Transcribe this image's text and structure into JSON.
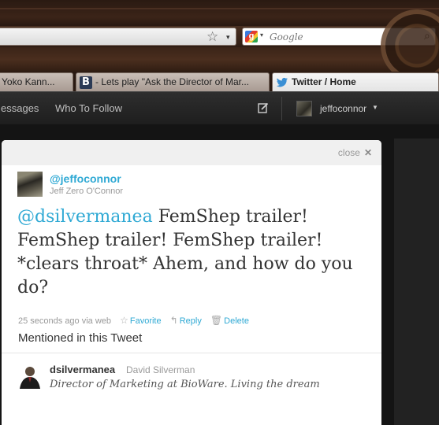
{
  "browser": {
    "search": {
      "placeholder": "Google"
    },
    "tabs": [
      {
        "label": "Yoko Kann..."
      },
      {
        "label": "- Lets play \"Ask the Director of Mar..."
      },
      {
        "label": "Twitter / Home"
      }
    ]
  },
  "twitter": {
    "nav": {
      "messages": "essages",
      "who_to_follow": "Who To Follow"
    },
    "user": {
      "name": "jeffoconnor"
    },
    "details": {
      "close_label": "close",
      "close_glyph": "✕",
      "author": {
        "screen_name": "@jeffoconnor",
        "real_name": "Jeff Zero O'Connor"
      },
      "tweet": {
        "mention": "@dsilvermanea",
        "text": " FemShep trailer! FemShep trailer! FemShep trailer! *clears throat* Ahem, and how do you do?"
      },
      "meta": {
        "time": "25 seconds ago",
        "via": "via web",
        "favorite": "Favorite",
        "reply": "Reply",
        "delete": "Delete"
      },
      "mentioned_heading": "Mentioned in this Tweet",
      "mentioned_user": {
        "screen_name": "dsilvermanea",
        "real_name": "David Silverman",
        "bio": "Director of Marketing at BioWare. Living the dream"
      }
    }
  },
  "colors": {
    "link": "#2fa9d4",
    "text": "#333333",
    "muted": "#999999",
    "topbar": "#222222"
  }
}
